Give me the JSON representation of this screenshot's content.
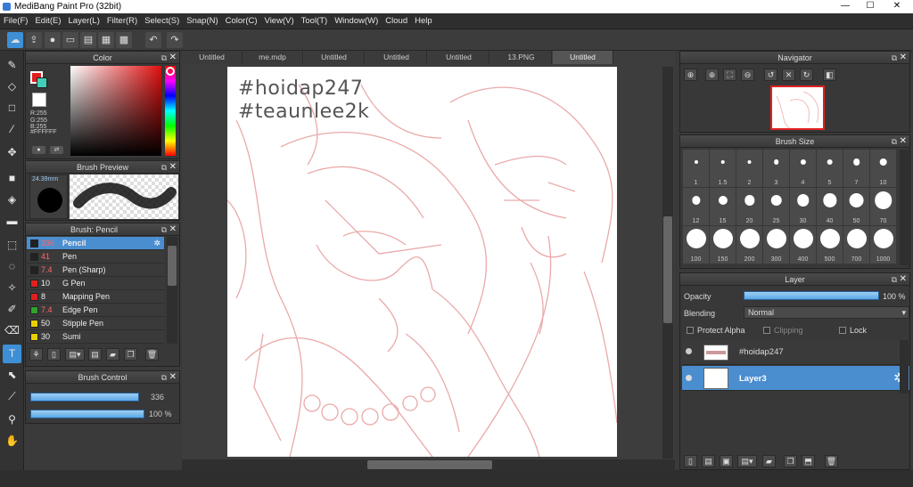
{
  "window": {
    "title": "MediBang Paint Pro (32bit)",
    "minimize": "—",
    "maximize": "☐",
    "close": "✕"
  },
  "menu": [
    "File(F)",
    "Edit(E)",
    "Layer(L)",
    "Filter(R)",
    "Select(S)",
    "Snap(N)",
    "Color(C)",
    "View(V)",
    "Tool(T)",
    "Window(W)",
    "Cloud",
    "Help"
  ],
  "tabs": [
    "Untitled",
    "me.mdp",
    "Untitled",
    "Untitled",
    "Untitled",
    "13.PNG",
    "Untitled"
  ],
  "active_tab_index": 6,
  "color_panel": {
    "title": "Color",
    "readout": [
      "R:255",
      "G:255",
      "B:255",
      "#FFFFFF"
    ],
    "fg_color": "#e02020",
    "accent_color": "#3fd0b5"
  },
  "brush_preview": {
    "title": "Brush Preview",
    "size": "24.39mm"
  },
  "brush_panel": {
    "title": "Brush: Pencil",
    "items": [
      {
        "size": "336",
        "name": "Pencil",
        "color": "#222222"
      },
      {
        "size": "41",
        "name": "Pen",
        "color": "#222222"
      },
      {
        "size": "7.4",
        "name": "Pen (Sharp)",
        "color": "#222222"
      },
      {
        "size": "10",
        "name": "G Pen",
        "color": "#e02020"
      },
      {
        "size": "8",
        "name": "Mapping Pen",
        "color": "#e02020"
      },
      {
        "size": "7.4",
        "name": "Edge Pen",
        "color": "#2fa12f"
      },
      {
        "size": "50",
        "name": "Stipple Pen",
        "color": "#e8d000"
      },
      {
        "size": "30",
        "name": "Sumi",
        "color": "#e8d000"
      }
    ]
  },
  "brush_control": {
    "title": "Brush Control",
    "size_value": "336",
    "opacity_value": "100 %",
    "size_fraction": 0.95,
    "opacity_fraction": 1.0
  },
  "canvas": {
    "line1": "#hoidap247",
    "line2": "#teaunlee2k"
  },
  "navigator": {
    "title": "Navigator"
  },
  "brush_size": {
    "title": "Brush Size",
    "sizes": [
      "1",
      "1.5",
      "2",
      "3",
      "4",
      "5",
      "7",
      "10",
      "12",
      "15",
      "20",
      "25",
      "30",
      "40",
      "50",
      "70",
      "100",
      "150",
      "200",
      "300",
      "400",
      "500",
      "700",
      "1000"
    ]
  },
  "layer_panel": {
    "title": "Layer",
    "opacity_label": "Opacity",
    "opacity_value": "100 %",
    "opacity_fraction": 1.0,
    "blending_label": "Blending",
    "blending_value": "Normal",
    "protect_alpha": "Protect Alpha",
    "clipping": "Clipping",
    "lock": "Lock",
    "layers": [
      {
        "name": "#hoidap247",
        "selected": false
      },
      {
        "name": "Layer3",
        "selected": true
      }
    ]
  }
}
